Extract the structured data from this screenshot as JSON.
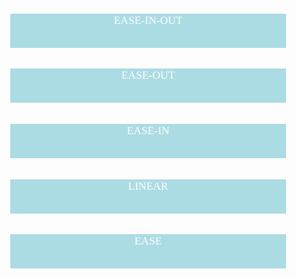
{
  "bars": [
    {
      "label": "EASE-IN-OUT"
    },
    {
      "label": "EASE-OUT"
    },
    {
      "label": "EASE-IN"
    },
    {
      "label": "LINEAR"
    },
    {
      "label": "EASE"
    }
  ],
  "colors": {
    "background": "#fdfdfd",
    "bar_fill": "#abdbe3",
    "label_text": "#ffffff"
  }
}
